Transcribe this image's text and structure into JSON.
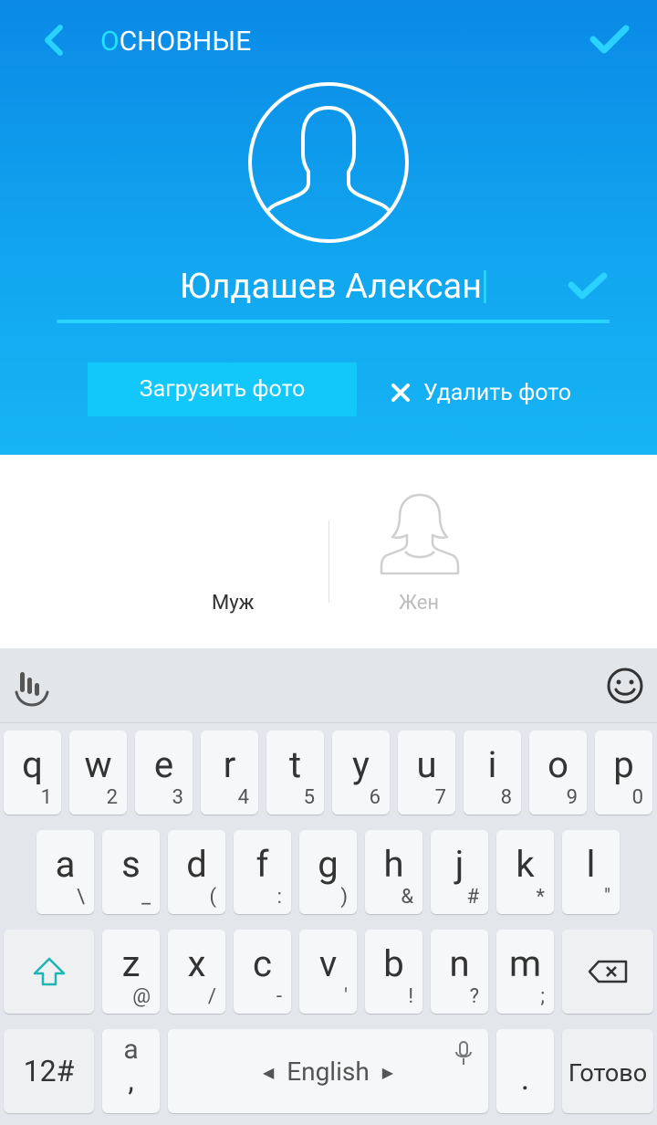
{
  "header": {
    "title_first": "О",
    "title_rest": "СНОВНЫЕ",
    "name_value": "Юлдашев Алексан",
    "upload_label": "Загрузить фото",
    "delete_label": "Удалить фото",
    "colors": {
      "accent": "#2ad2ff",
      "header_bg": "#0a8ae6",
      "button_bg": "#12c8fb"
    }
  },
  "gender": {
    "male_label": "Муж",
    "female_label": "Жен"
  },
  "keyboard": {
    "row1": [
      {
        "main": "q",
        "sub": "1"
      },
      {
        "main": "w",
        "sub": "2"
      },
      {
        "main": "e",
        "sub": "3"
      },
      {
        "main": "r",
        "sub": "4"
      },
      {
        "main": "t",
        "sub": "5"
      },
      {
        "main": "y",
        "sub": "6"
      },
      {
        "main": "u",
        "sub": "7"
      },
      {
        "main": "i",
        "sub": "8"
      },
      {
        "main": "o",
        "sub": "9"
      },
      {
        "main": "p",
        "sub": "0"
      }
    ],
    "row2": [
      {
        "main": "a",
        "sub": "\\"
      },
      {
        "main": "s",
        "sub": "_"
      },
      {
        "main": "d",
        "sub": "("
      },
      {
        "main": "f",
        "sub": ":"
      },
      {
        "main": "g",
        "sub": ")"
      },
      {
        "main": "h",
        "sub": "&"
      },
      {
        "main": "j",
        "sub": "#"
      },
      {
        "main": "k",
        "sub": "*"
      },
      {
        "main": "l",
        "sub": "\""
      }
    ],
    "row3": [
      {
        "main": "z",
        "sub": "@"
      },
      {
        "main": "x",
        "sub": "/"
      },
      {
        "main": "c",
        "sub": "-"
      },
      {
        "main": "v",
        "sub": "'"
      },
      {
        "main": "b",
        "sub": "!"
      },
      {
        "main": "n",
        "sub": "?"
      },
      {
        "main": "m",
        "sub": ";"
      }
    ],
    "num_label": "12#",
    "comma_main": "a",
    "comma_sub": ",",
    "space_label": "English",
    "period_label": ".",
    "done_label": "Готово",
    "icons": [
      "touchpal-logo-icon",
      "emoji-icon",
      "shift-icon",
      "backspace-icon",
      "mic-icon"
    ]
  }
}
